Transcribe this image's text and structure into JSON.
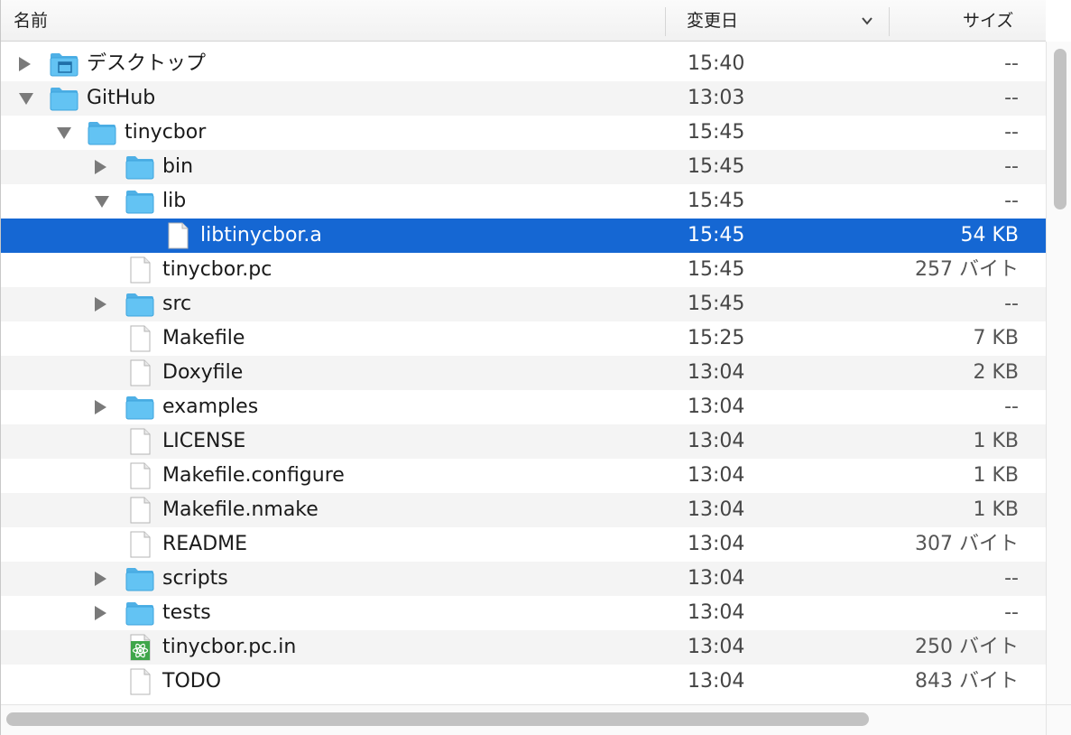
{
  "header": {
    "name_label": "名前",
    "date_label": "変更日",
    "size_label": "サイズ"
  },
  "rows": [
    {
      "name": "デスクトップ",
      "date": "15:40",
      "size": "--",
      "level": 0,
      "type": "desktop-folder",
      "disclosure": "closed",
      "icon": "desktop-folder-icon"
    },
    {
      "name": "GitHub",
      "date": "13:03",
      "size": "--",
      "level": 0,
      "type": "folder",
      "disclosure": "open",
      "icon": "folder-icon"
    },
    {
      "name": "tinycbor",
      "date": "15:45",
      "size": "--",
      "level": 1,
      "type": "folder",
      "disclosure": "open",
      "icon": "folder-icon"
    },
    {
      "name": "bin",
      "date": "15:45",
      "size": "--",
      "level": 2,
      "type": "folder",
      "disclosure": "closed",
      "icon": "folder-icon"
    },
    {
      "name": "lib",
      "date": "15:45",
      "size": "--",
      "level": 2,
      "type": "folder",
      "disclosure": "open",
      "icon": "folder-icon"
    },
    {
      "name": "libtinycbor.a",
      "date": "15:45",
      "size": "54 KB",
      "level": 3,
      "type": "file",
      "disclosure": "none",
      "icon": "document-icon",
      "selected": true
    },
    {
      "name": "tinycbor.pc",
      "date": "15:45",
      "size": "257 バイト",
      "level": 2,
      "type": "file",
      "disclosure": "none",
      "icon": "document-icon"
    },
    {
      "name": "src",
      "date": "15:45",
      "size": "--",
      "level": 2,
      "type": "folder",
      "disclosure": "closed",
      "icon": "folder-icon"
    },
    {
      "name": "Makefile",
      "date": "15:25",
      "size": "7 KB",
      "level": 2,
      "type": "file",
      "disclosure": "none",
      "icon": "document-icon"
    },
    {
      "name": "Doxyfile",
      "date": "13:04",
      "size": "2 KB",
      "level": 2,
      "type": "file",
      "disclosure": "none",
      "icon": "document-icon"
    },
    {
      "name": "examples",
      "date": "13:04",
      "size": "--",
      "level": 2,
      "type": "folder",
      "disclosure": "closed",
      "icon": "folder-icon"
    },
    {
      "name": "LICENSE",
      "date": "13:04",
      "size": "1 KB",
      "level": 2,
      "type": "file",
      "disclosure": "none",
      "icon": "document-icon"
    },
    {
      "name": "Makefile.configure",
      "date": "13:04",
      "size": "1 KB",
      "level": 2,
      "type": "file",
      "disclosure": "none",
      "icon": "document-icon"
    },
    {
      "name": "Makefile.nmake",
      "date": "13:04",
      "size": "1 KB",
      "level": 2,
      "type": "file",
      "disclosure": "none",
      "icon": "document-icon"
    },
    {
      "name": "README",
      "date": "13:04",
      "size": "307 バイト",
      "level": 2,
      "type": "file",
      "disclosure": "none",
      "icon": "document-icon"
    },
    {
      "name": "scripts",
      "date": "13:04",
      "size": "--",
      "level": 2,
      "type": "folder",
      "disclosure": "closed",
      "icon": "folder-icon"
    },
    {
      "name": "tests",
      "date": "13:04",
      "size": "--",
      "level": 2,
      "type": "folder",
      "disclosure": "closed",
      "icon": "folder-icon"
    },
    {
      "name": "tinycbor.pc.in",
      "date": "13:04",
      "size": "250 バイト",
      "level": 2,
      "type": "atom-file",
      "disclosure": "none",
      "icon": "atom-document-icon"
    },
    {
      "name": "TODO",
      "date": "13:04",
      "size": "843 バイト",
      "level": 2,
      "type": "file",
      "disclosure": "none",
      "icon": "document-icon"
    }
  ],
  "colors": {
    "selection": "#1567d3",
    "folder": "#63c3f3",
    "alt_row": "#f4f4f4",
    "disclosure": "#7a7a7a"
  }
}
